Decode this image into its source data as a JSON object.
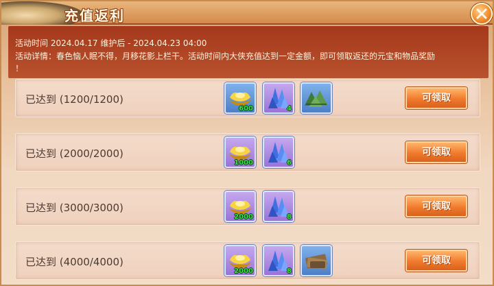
{
  "dialog": {
    "title": "充值返利",
    "close_icon": "close-icon"
  },
  "info": {
    "time_line": "活动时间  2024.04.17 维护后 - 2024.04.23 04:00",
    "detail_line": "活动详情：春色恼人眠不得，月移花影上栏干。活动时间内大侠充值达到一定金额，即可领取返还的元宝和物品奖励",
    "detail_tail": "！"
  },
  "colors": {
    "banner": "#a5381b",
    "button": "#f07a2c",
    "quantity": "#39e24c",
    "slot_blue": "#4d7fc8",
    "slot_purple": "#9a73d8"
  },
  "tiers": [
    {
      "label": "已达到 (1200/1200)",
      "button": "可领取",
      "rewards": [
        {
          "icon": "gold-ingot-icon",
          "quality": "blue",
          "qty": "600"
        },
        {
          "icon": "crystal-icon",
          "quality": "purple",
          "qty": "4"
        },
        {
          "icon": "zongzi-icon",
          "quality": "blue",
          "qty": ""
        }
      ]
    },
    {
      "label": "已达到 (2000/2000)",
      "button": "可领取",
      "rewards": [
        {
          "icon": "gold-ingot-icon",
          "quality": "purple",
          "qty": "1000"
        },
        {
          "icon": "crystal-icon",
          "quality": "purple",
          "qty": "6"
        }
      ]
    },
    {
      "label": "已达到 (3000/3000)",
      "button": "可领取",
      "rewards": [
        {
          "icon": "gold-ingot-icon",
          "quality": "purple",
          "qty": "2000"
        },
        {
          "icon": "crystal-icon",
          "quality": "purple",
          "qty": "8"
        }
      ]
    },
    {
      "label": "已达到 (4000/4000)",
      "button": "可领取",
      "rewards": [
        {
          "icon": "gold-ingot-icon",
          "quality": "purple",
          "qty": "2000"
        },
        {
          "icon": "crystal-icon",
          "quality": "purple",
          "qty": "8"
        },
        {
          "icon": "scroll-bundle-icon",
          "quality": "blue",
          "qty": ""
        }
      ]
    }
  ]
}
